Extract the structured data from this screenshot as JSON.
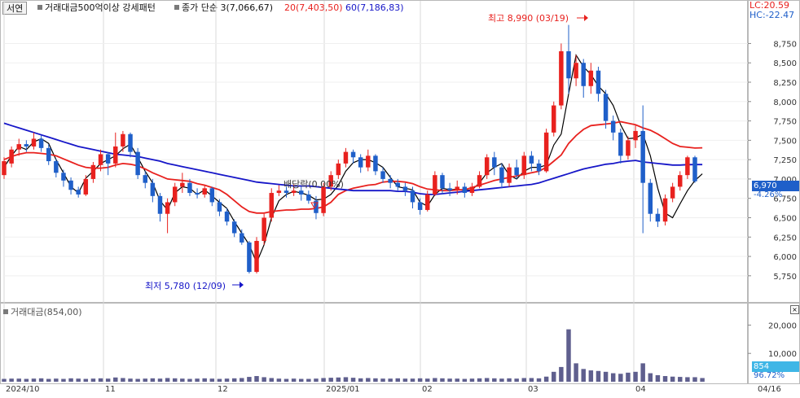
{
  "toolbar": {
    "tab_label": "서연",
    "condition_label": "거래대금500억이상 강세패턴",
    "ma_label": "종가 단순 3(7,066,67)",
    "ma20_label": "20(7,403,50)",
    "ma60_label": "60(7,186,83)"
  },
  "right_header": {
    "lc": "LC:20.59",
    "hc": "HC:-22.47"
  },
  "annotations": {
    "high": "최고 8,990 (03/19)",
    "low": "최저 5,780 (12/09)",
    "dividend": "배당락(0.00%)"
  },
  "current": {
    "price": "6,970",
    "change": "-4.26%",
    "volume": "854",
    "volume_pct": "96.72%"
  },
  "volume_pane": {
    "label": "거래대금(854,00)"
  },
  "colors": {
    "up": "#e8211e",
    "down": "#1f5fc9",
    "ma3": "#000000",
    "ma20": "#e8211e",
    "ma60": "#1616c8",
    "volume": "#5f5f8e",
    "price_box": "#1f5fc9",
    "volume_box": "#3fb6e6"
  },
  "chart_data": [
    {
      "type": "candlestick",
      "x_labels": [
        "2024/10",
        "11",
        "12",
        "2025/01",
        "02",
        "03",
        "04",
        "04/16"
      ],
      "y_ticks": [
        5750,
        6000,
        6250,
        6500,
        6750,
        7000,
        7250,
        7500,
        7750,
        8000,
        8250,
        8500,
        8750
      ],
      "ylim": [
        5580,
        9070
      ],
      "series": [
        {
          "name": "3",
          "values": [
            7150,
            7300,
            7420,
            7380,
            7480,
            7520,
            7460,
            7250,
            7080,
            6900,
            6820,
            7010,
            7100,
            7200,
            7250,
            7300,
            7390,
            7450,
            7280,
            7100,
            6950,
            6720,
            6600,
            6820,
            6900,
            6880,
            6800,
            6860,
            6780,
            6700,
            6620,
            6450,
            6300,
            6150,
            5920,
            6150,
            6500,
            6720,
            6800,
            6840,
            6820,
            6790,
            6730,
            6740,
            6800,
            6920,
            7100,
            7210,
            7250,
            7250,
            7210,
            7150,
            7020,
            6900,
            6880,
            6860,
            6700,
            6650,
            6800,
            6880,
            6860,
            6870,
            6850,
            6860,
            6950,
            7080,
            7150,
            7200,
            7050,
            7000,
            7100,
            7150,
            7150,
            7180,
            7440,
            7580,
            8100,
            8600,
            8450,
            8350,
            8200,
            8100,
            7950,
            7700,
            7520,
            7530,
            7580,
            7300,
            6880,
            6560,
            6500,
            6680,
            6850,
            6980,
            7066
          ]
        },
        {
          "name": "20",
          "values": [
            7250,
            7290,
            7320,
            7340,
            7340,
            7330,
            7320,
            7300,
            7260,
            7220,
            7180,
            7150,
            7140,
            7140,
            7150,
            7180,
            7200,
            7190,
            7170,
            7130,
            7080,
            7040,
            7000,
            6990,
            6980,
            6970,
            6940,
            6920,
            6890,
            6860,
            6800,
            6720,
            6640,
            6580,
            6560,
            6560,
            6580,
            6590,
            6600,
            6600,
            6610,
            6610,
            6620,
            6640,
            6700,
            6800,
            6850,
            6880,
            6900,
            6920,
            6930,
            6960,
            6970,
            6970,
            6960,
            6940,
            6900,
            6870,
            6860,
            6850,
            6850,
            6860,
            6860,
            6890,
            6920,
            6950,
            6980,
            7000,
            7020,
            7040,
            7060,
            7080,
            7100,
            7150,
            7230,
            7310,
            7460,
            7560,
            7640,
            7690,
            7700,
            7710,
            7720,
            7740,
            7720,
            7700,
            7660,
            7630,
            7580,
            7520,
            7460,
            7420,
            7410,
            7400,
            7403
          ]
        },
        {
          "name": "60",
          "values": [
            7720,
            7690,
            7660,
            7630,
            7600,
            7570,
            7540,
            7510,
            7480,
            7450,
            7420,
            7400,
            7380,
            7360,
            7340,
            7320,
            7310,
            7300,
            7290,
            7270,
            7250,
            7230,
            7200,
            7180,
            7160,
            7140,
            7120,
            7100,
            7080,
            7060,
            7040,
            7020,
            7000,
            6980,
            6960,
            6950,
            6940,
            6930,
            6920,
            6910,
            6910,
            6910,
            6900,
            6890,
            6880,
            6870,
            6860,
            6850,
            6850,
            6850,
            6850,
            6850,
            6850,
            6840,
            6840,
            6830,
            6810,
            6800,
            6800,
            6810,
            6820,
            6830,
            6840,
            6850,
            6860,
            6870,
            6880,
            6890,
            6900,
            6910,
            6920,
            6930,
            6950,
            6980,
            7010,
            7040,
            7070,
            7100,
            7130,
            7150,
            7170,
            7190,
            7200,
            7220,
            7230,
            7240,
            7220,
            7210,
            7200,
            7190,
            7180,
            7180,
            7185,
            7186,
            7186
          ]
        }
      ],
      "candles": [
        [
          7050,
          7230,
          7000,
          7280
        ],
        [
          7200,
          7380,
          7150,
          7420
        ],
        [
          7380,
          7450,
          7300,
          7520
        ],
        [
          7450,
          7420,
          7350,
          7500
        ],
        [
          7420,
          7520,
          7380,
          7600
        ],
        [
          7520,
          7400,
          7350,
          7560
        ],
        [
          7400,
          7230,
          7180,
          7450
        ],
        [
          7230,
          7080,
          7020,
          7260
        ],
        [
          7080,
          6980,
          6900,
          7120
        ],
        [
          6980,
          6860,
          6800,
          7020
        ],
        [
          6860,
          6800,
          6760,
          6900
        ],
        [
          6800,
          7000,
          6780,
          7050
        ],
        [
          7000,
          7180,
          6950,
          7220
        ],
        [
          7180,
          7320,
          7100,
          7380
        ],
        [
          7320,
          7200,
          7050,
          7350
        ],
        [
          7200,
          7420,
          7150,
          7600
        ],
        [
          7420,
          7580,
          7350,
          7620
        ],
        [
          7580,
          7350,
          7280,
          7600
        ],
        [
          7350,
          7050,
          7000,
          7400
        ],
        [
          7050,
          6950,
          6880,
          7100
        ],
        [
          6950,
          6780,
          6700,
          7000
        ],
        [
          6780,
          6550,
          6450,
          6820
        ],
        [
          6550,
          6700,
          6300,
          6750
        ],
        [
          6700,
          6900,
          6650,
          6950
        ],
        [
          6900,
          6950,
          6820,
          7080
        ],
        [
          6950,
          6820,
          6780,
          7000
        ],
        [
          6820,
          6800,
          6750,
          6880
        ],
        [
          6800,
          6880,
          6760,
          6920
        ],
        [
          6880,
          6700,
          6650,
          6900
        ],
        [
          6700,
          6580,
          6520,
          6740
        ],
        [
          6580,
          6450,
          6400,
          6620
        ],
        [
          6450,
          6300,
          6250,
          6480
        ],
        [
          6300,
          6180,
          6150,
          6350
        ],
        [
          6180,
          5800,
          5780,
          6200
        ],
        [
          5800,
          6200,
          5780,
          6250
        ],
        [
          6200,
          6500,
          6150,
          6550
        ],
        [
          6500,
          6820,
          6450,
          6880
        ],
        [
          6820,
          6850,
          6780,
          6920
        ],
        [
          6850,
          6820,
          6760,
          6900
        ],
        [
          6820,
          6850,
          6780,
          6930
        ],
        [
          6850,
          6800,
          6720,
          6900
        ],
        [
          6800,
          6720,
          6680,
          6850
        ],
        [
          6720,
          6560,
          6480,
          6780
        ],
        [
          6560,
          6900,
          6520,
          6950
        ],
        [
          6900,
          7050,
          6850,
          7100
        ],
        [
          7050,
          7200,
          7000,
          7250
        ],
        [
          7200,
          7350,
          7150,
          7400
        ],
        [
          7350,
          7280,
          7200,
          7380
        ],
        [
          7280,
          7150,
          7080,
          7320
        ],
        [
          7150,
          7300,
          7100,
          7380
        ],
        [
          7300,
          7100,
          7050,
          7320
        ],
        [
          7100,
          7000,
          6950,
          7150
        ],
        [
          7000,
          6950,
          6880,
          7050
        ],
        [
          6950,
          6900,
          6850,
          7000
        ],
        [
          6900,
          6850,
          6780,
          6950
        ],
        [
          6850,
          6700,
          6620,
          6900
        ],
        [
          6700,
          6600,
          6540,
          6750
        ],
        [
          6600,
          6800,
          6580,
          6850
        ],
        [
          6800,
          7050,
          6780,
          7100
        ],
        [
          7050,
          6880,
          6800,
          7080
        ],
        [
          6880,
          6850,
          6780,
          6950
        ],
        [
          6850,
          6900,
          6800,
          6980
        ],
        [
          6900,
          6820,
          6760,
          6950
        ],
        [
          6820,
          6900,
          6780,
          6950
        ],
        [
          6900,
          7050,
          6880,
          7100
        ],
        [
          7050,
          7280,
          7000,
          7320
        ],
        [
          7280,
          7150,
          7050,
          7350
        ],
        [
          7150,
          6950,
          6880,
          7200
        ],
        [
          6950,
          7150,
          6900,
          7200
        ],
        [
          7150,
          7050,
          7000,
          7250
        ],
        [
          7050,
          7300,
          7000,
          7350
        ],
        [
          7300,
          7200,
          7100,
          7360
        ],
        [
          7200,
          7100,
          7050,
          7250
        ],
        [
          7100,
          7600,
          7080,
          7650
        ],
        [
          7600,
          7950,
          7550,
          8000
        ],
        [
          7950,
          8650,
          7900,
          8750
        ],
        [
          8650,
          8300,
          8100,
          8990
        ],
        [
          8300,
          8500,
          8200,
          8600
        ],
        [
          8500,
          8200,
          8050,
          8550
        ],
        [
          8200,
          8400,
          8100,
          8500
        ],
        [
          8400,
          8100,
          8000,
          8450
        ],
        [
          8100,
          7750,
          7650,
          8150
        ],
        [
          7750,
          7600,
          7500,
          7820
        ],
        [
          7600,
          7300,
          7200,
          7650
        ],
        [
          7300,
          7500,
          7250,
          7550
        ],
        [
          7500,
          7620,
          7400,
          7700
        ],
        [
          7620,
          6950,
          6300,
          7950
        ],
        [
          6950,
          6550,
          6450,
          7000
        ],
        [
          6550,
          6450,
          6380,
          6620
        ],
        [
          6450,
          6750,
          6400,
          6800
        ],
        [
          6750,
          6900,
          6700,
          6950
        ],
        [
          6900,
          7050,
          6850,
          7100
        ],
        [
          7050,
          7280,
          7000,
          7300
        ],
        [
          7280,
          6970,
          6950,
          7300
        ]
      ],
      "volume": [
        100,
        110,
        110,
        100,
        110,
        120,
        100,
        110,
        100,
        120,
        110,
        100,
        110,
        120,
        110,
        150,
        130,
        110,
        100,
        110,
        120,
        110,
        130,
        120,
        110,
        100,
        110,
        120,
        110,
        100,
        110,
        120,
        130,
        170,
        200,
        160,
        130,
        110,
        100,
        110,
        100,
        100,
        110,
        130,
        140,
        150,
        160,
        140,
        120,
        130,
        120,
        110,
        110,
        120,
        110,
        110,
        120,
        110,
        130,
        120,
        110,
        110,
        100,
        110,
        120,
        130,
        120,
        110,
        120,
        110,
        130,
        130,
        120,
        180,
        350,
        520,
        1850,
        650,
        450,
        400,
        380,
        350,
        300,
        280,
        320,
        350,
        650,
        300,
        230,
        200,
        180,
        170,
        160,
        160,
        130
      ],
      "volume_ticks": [
        10000,
        20000
      ],
      "volume_ylim": [
        0,
        2500
      ]
    }
  ]
}
